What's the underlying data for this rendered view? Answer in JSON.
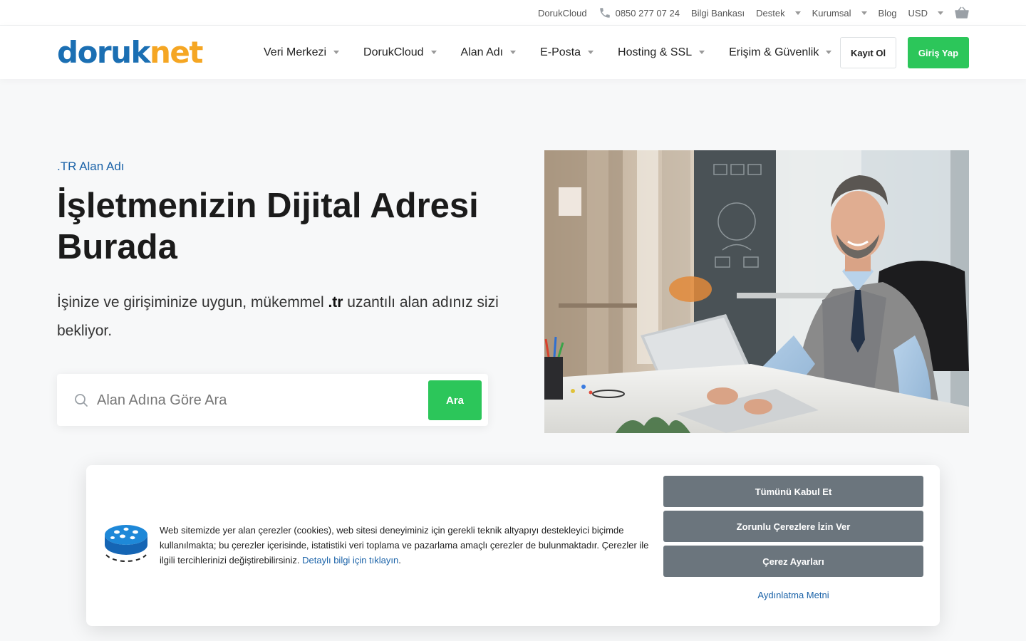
{
  "topbar": {
    "items": [
      {
        "label": "DorukCloud"
      },
      {
        "label": "0850 277 07 24",
        "icon": "phone-icon"
      },
      {
        "label": "Bilgi Bankası"
      },
      {
        "label": "Destek",
        "dropdown": true
      },
      {
        "label": "Kurumsal",
        "dropdown": true
      },
      {
        "label": "Blog"
      },
      {
        "label": "USD",
        "dropdown": true
      }
    ],
    "cart_icon": "basket-icon"
  },
  "logo": {
    "part1": "doruk",
    "part2": "net"
  },
  "nav": {
    "items": [
      {
        "label": "Veri Merkezi"
      },
      {
        "label": "DorukCloud"
      },
      {
        "label": "Alan Adı"
      },
      {
        "label": "E-Posta"
      },
      {
        "label": "Hosting & SSL"
      },
      {
        "label": "Erişim & Güvenlik"
      }
    ],
    "register_label": "Kayıt Ol",
    "login_label": "Giriş Yap"
  },
  "hero": {
    "eyebrow": ".TR Alan Adı",
    "title": "İşletmenizin Dijital Adresi Burada",
    "desc_before": "İşinize ve girişiminize uygun, mükemmel ",
    "desc_bold": ".tr",
    "desc_after": " uzantılı alan adınız sizi bekliyor.",
    "search_placeholder": "Alan Adına Göre Ara",
    "search_value": "",
    "search_button": "Ara"
  },
  "cookie": {
    "text": "Web sitemizde yer alan çerezler (cookies), web sitesi deneyiminiz için gerekli teknik altyapıyı destekleyici biçimde kullanılmakta; bu çerezler içerisinde, istatistiki veri toplama ve pazarlama amaçlı çerezler de bulunmaktadır. Çerezler ile ilgili tercihlerinizi değiştirebilirsiniz. ",
    "link": "Detaylı bilgi için tıklayın",
    "link_suffix": ".",
    "accept_all": "Tümünü Kabul Et",
    "necessary_only": "Zorunlu Çerezlere İzin Ver",
    "settings": "Çerez Ayarları",
    "privacy": "Aydınlatma Metni"
  },
  "colors": {
    "brand_blue": "#1b6fb3",
    "brand_orange": "#f5a623",
    "cta_green": "#2cc65a",
    "cookie_button": "#6b757d",
    "link_blue": "#1a62a8"
  }
}
